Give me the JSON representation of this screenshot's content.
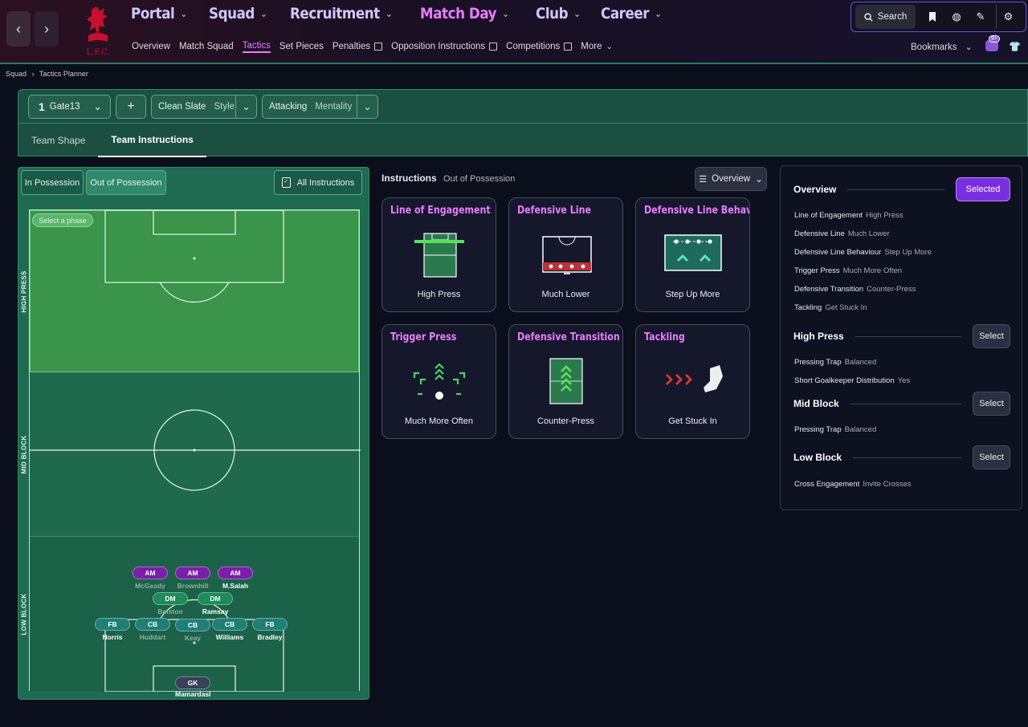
{
  "nav": {
    "back_icon": "chevron-left-icon",
    "forward_icon": "chevron-right-icon",
    "club_crest_text": "L.F.C.",
    "main": [
      "Portal",
      "Squad",
      "Recruitment",
      "Match Day",
      "Club",
      "Career"
    ],
    "active_main": "Match Day",
    "sub": [
      "Overview",
      "Match Squad",
      "Tactics",
      "Set Pieces",
      "Penalties",
      "Opposition Instructions",
      "Competitions",
      "More"
    ],
    "active_sub": "Tactics",
    "search_label": "Search",
    "bookmarks_label": "Bookmarks",
    "notifications_badge": "9+"
  },
  "breadcrumb": {
    "parent": "Squad",
    "current": "Tactics Planner"
  },
  "tactic": {
    "slot_number": "1",
    "name": "Gate13",
    "style_value": "Clean Slate",
    "style_label": "Style",
    "mentality_value": "Attacking",
    "mentality_label": "Mentality",
    "tabs": [
      "Team Shape",
      "Team Instructions"
    ],
    "active_tab": "Team Instructions"
  },
  "pitch_panel": {
    "in_possession": "In Possession",
    "out_of_possession": "Out of Possession",
    "all_instructions": "All Instructions",
    "select_phase": "Select a phase",
    "zones": [
      "HIGH PRESS",
      "MID BLOCK",
      "LOW BLOCK"
    ],
    "players": [
      {
        "pos": "AM",
        "name": "McGeady",
        "dim": true
      },
      {
        "pos": "AM",
        "name": "Brownhill",
        "dim": true
      },
      {
        "pos": "AM",
        "name": "M.Salah",
        "dim": false
      },
      {
        "pos": "DM",
        "name": "Belston",
        "dim": true
      },
      {
        "pos": "DM",
        "name": "Ramsay",
        "dim": false
      },
      {
        "pos": "FB",
        "name": "Norris",
        "dim": false
      },
      {
        "pos": "CB",
        "name": "Huddart",
        "dim": true
      },
      {
        "pos": "CB",
        "name": "Keay",
        "dim": true
      },
      {
        "pos": "CB",
        "name": "Williams",
        "dim": false
      },
      {
        "pos": "FB",
        "name": "Bradley",
        "dim": false
      },
      {
        "pos": "GK",
        "name": "Mamardashvili",
        "dim": false
      }
    ],
    "colors": {
      "am": "#7a1fa8",
      "dm": "#1f8a5a",
      "def": "#1f7f78",
      "gk": "#3a3f5c"
    }
  },
  "instructions": {
    "heading": "Instructions",
    "context": "Out of Possession",
    "view_label": "Overview",
    "cards": [
      {
        "title": "Line of Engagement",
        "value": "High Press",
        "icon": "engagement-line-icon"
      },
      {
        "title": "Defensive Line",
        "value": "Much Lower",
        "icon": "defensive-line-icon"
      },
      {
        "title": "Defensive Line Behavio",
        "value": "Step Up More",
        "icon": "step-up-icon"
      },
      {
        "title": "Trigger Press",
        "value": "Much More Often",
        "icon": "trigger-press-icon"
      },
      {
        "title": "Defensive Transition",
        "value": "Counter-Press",
        "icon": "counter-press-icon"
      },
      {
        "title": "Tackling",
        "value": "Get Stuck In",
        "icon": "boot-icon"
      }
    ]
  },
  "overview": {
    "title": "Overview",
    "selected_label": "Selected",
    "items": [
      {
        "k": "Line of Engagement",
        "v": "High Press"
      },
      {
        "k": "Defensive Line",
        "v": "Much Lower"
      },
      {
        "k": "Defensive Line Behaviour",
        "v": "Step Up More"
      },
      {
        "k": "Trigger Press",
        "v": "Much More Often"
      },
      {
        "k": "Defensive Transition",
        "v": "Counter-Press"
      },
      {
        "k": "Tackling",
        "v": "Get Stuck In"
      }
    ],
    "high_press": {
      "title": "High Press",
      "button": "Select",
      "items": [
        {
          "k": "Pressing Trap",
          "v": "Balanced"
        },
        {
          "k": "Short Goalkeeper Distribution",
          "v": "Yes"
        }
      ]
    },
    "mid_block": {
      "title": "Mid Block",
      "button": "Select",
      "items": [
        {
          "k": "Pressing Trap",
          "v": "Balanced"
        }
      ]
    },
    "low_block": {
      "title": "Low Block",
      "button": "Select",
      "items": [
        {
          "k": "Cross Engagement",
          "v": "Invite Crosses"
        }
      ]
    }
  }
}
